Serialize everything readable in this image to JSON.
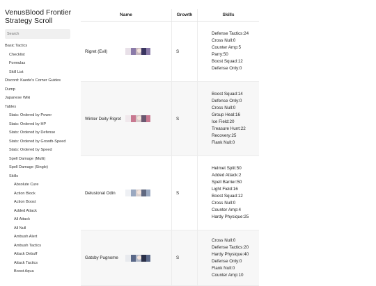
{
  "sidebar": {
    "title": "VenusBlood Frontier Strategy Scroll",
    "search_placeholder": "Search",
    "items": [
      {
        "label": "Basic Tactics",
        "level": 1
      },
      {
        "label": "Checklist",
        "level": 2
      },
      {
        "label": "Formulas",
        "level": 2
      },
      {
        "label": "Skill List",
        "level": 2
      },
      {
        "label": "Discord: Kaede's Corner Guides",
        "level": 1
      },
      {
        "label": "Dump",
        "level": 1
      },
      {
        "label": "Japanese Wiki",
        "level": 1
      },
      {
        "label": "Tables",
        "level": 1
      },
      {
        "label": "Stats: Ordered by Power",
        "level": 2
      },
      {
        "label": "Stats: Ordered by HP",
        "level": 2
      },
      {
        "label": "Stats: Ordered by Defense",
        "level": 2
      },
      {
        "label": "Stats: Ordered by Growth-Speed",
        "level": 2
      },
      {
        "label": "Stats: Ordered by Speed",
        "level": 2
      },
      {
        "label": "Spell Damage (Multi)",
        "level": 2
      },
      {
        "label": "Spell Damage (Single)",
        "level": 2
      },
      {
        "label": "Skills",
        "level": 2
      },
      {
        "label": "Absolute Cure",
        "level": 3
      },
      {
        "label": "Action Block",
        "level": 3
      },
      {
        "label": "Action Boost",
        "level": 3
      },
      {
        "label": "Added Attack",
        "level": 3
      },
      {
        "label": "All Attack",
        "level": 3
      },
      {
        "label": "All Null",
        "level": 3
      },
      {
        "label": "Ambush Alert",
        "level": 3
      },
      {
        "label": "Ambush Tactics",
        "level": 3
      },
      {
        "label": "Attack Debuff",
        "level": 3
      },
      {
        "label": "Attack Tactics",
        "level": 3
      },
      {
        "label": "Boost Aqua",
        "level": 3
      }
    ]
  },
  "table": {
    "headers": {
      "name": "Name",
      "growth": "Growth",
      "skills": "Skills"
    },
    "rows": [
      {
        "name": "Rigret (Evil)",
        "growth": "S",
        "portrait_colors": [
          "#e8e0e8",
          "#8a7aa8",
          "#3a3560",
          "#c8b8c0"
        ],
        "skills": [
          "Defense Tactics:24",
          "Cross Null:0",
          "Counter Amp:5",
          "Parry:50",
          "Boost Squad:12",
          "Defense Only:0"
        ]
      },
      {
        "name": "Winter Deity Rigret",
        "growth": "S",
        "portrait_colors": [
          "#f0e8ec",
          "#c87890",
          "#6a5870",
          "#d8c8c8"
        ],
        "skills": [
          "Boost Squad:14",
          "Defense Only:0",
          "Cross Null:0",
          "Group Heal:16",
          "Ice Field:20",
          "Treasure Hunt:22",
          "Recovery:25",
          "Flank Null:0"
        ]
      },
      {
        "name": "Delusional Odin",
        "growth": "S",
        "portrait_colors": [
          "#eef0f4",
          "#9aa8c0",
          "#606880",
          "#d8d0d0"
        ],
        "skills": [
          "Helmet Split:50",
          "Added Attack:2",
          "Spell Barrier:50",
          "Light Field:16",
          "Boost Squad:12",
          "Cross Null:0",
          "Counter Amp:4",
          "Hardy Physique:25"
        ]
      },
      {
        "name": "Gatsby Pugnome",
        "growth": "S",
        "portrait_colors": [
          "#e8eaee",
          "#5a6888",
          "#2a3048",
          "#b0b8c8"
        ],
        "skills": [
          "Cross Null:0",
          "Defense Tactics:20",
          "Hardy Physique:40",
          "Defense Only:0",
          "Flank Null:0",
          "Counter Amp:10"
        ]
      }
    ]
  }
}
